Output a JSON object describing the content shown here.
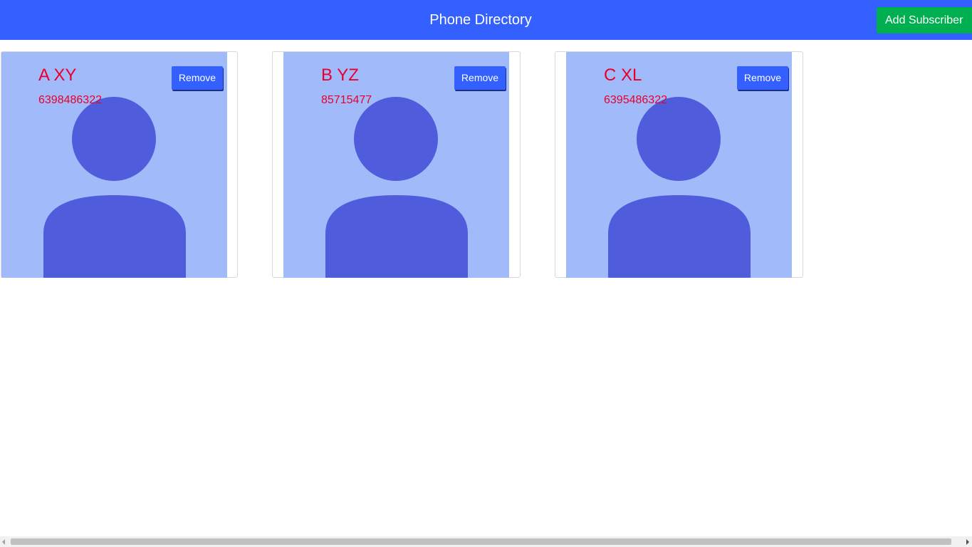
{
  "header": {
    "title": "Phone Directory",
    "add_button_label": "Add Subscriber",
    "background_color": "#3360ff",
    "add_button_color": "#00b050"
  },
  "subscribers": [
    {
      "name": "A XY",
      "phone": "6398486322",
      "remove_label": "Remove",
      "avatar_icon": "person-avatar-icon"
    },
    {
      "name": "B YZ",
      "phone": "85715477",
      "remove_label": "Remove",
      "avatar_icon": "person-avatar-icon"
    },
    {
      "name": "C XL",
      "phone": "6395486322",
      "remove_label": "Remove",
      "avatar_icon": "person-avatar-icon"
    }
  ],
  "colors": {
    "text_accent": "#e8002a",
    "avatar_background": "#a1bbfa",
    "avatar_figure": "#4f5cdc",
    "remove_button": "#3360ff"
  }
}
